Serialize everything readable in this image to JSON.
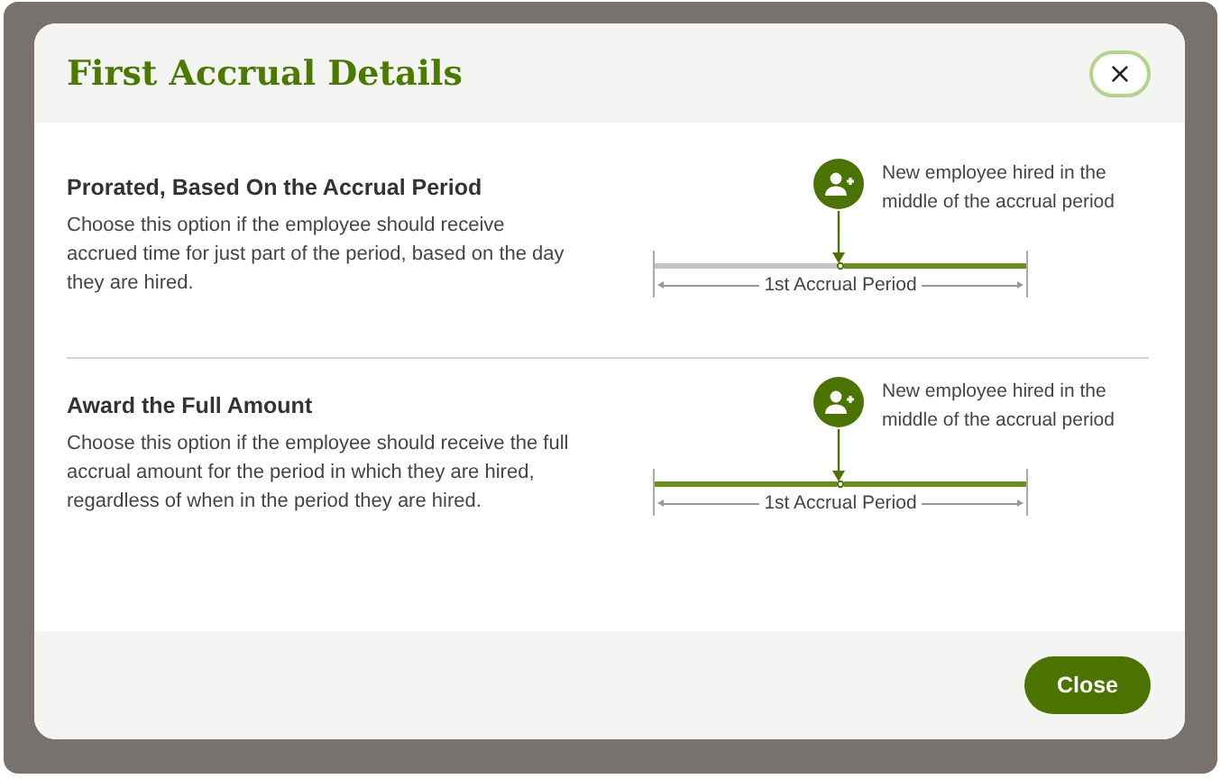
{
  "dialog": {
    "title": "First Accrual Details",
    "close_icon": "×",
    "options": [
      {
        "title": "Prorated, Based On the Accrual Period",
        "description": "Choose this option if the employee should receive accrued time for just part of the period, based on the day they are hired.",
        "diagram": {
          "before_hire_filled": false,
          "note": "New employee hired in the middle of the accrual period",
          "period_label": "1st Accrual Period"
        }
      },
      {
        "title": "Award the Full Amount",
        "description": "Choose this option if the employee should receive the full accrual amount for the period in which they are hired, regardless of when in the period they are hired.",
        "diagram": {
          "before_hire_filled": true,
          "note": "New employee hired in the middle of the accrual period",
          "period_label": "1st Accrual Period"
        }
      }
    ],
    "buttons": [
      "Close"
    ]
  }
}
